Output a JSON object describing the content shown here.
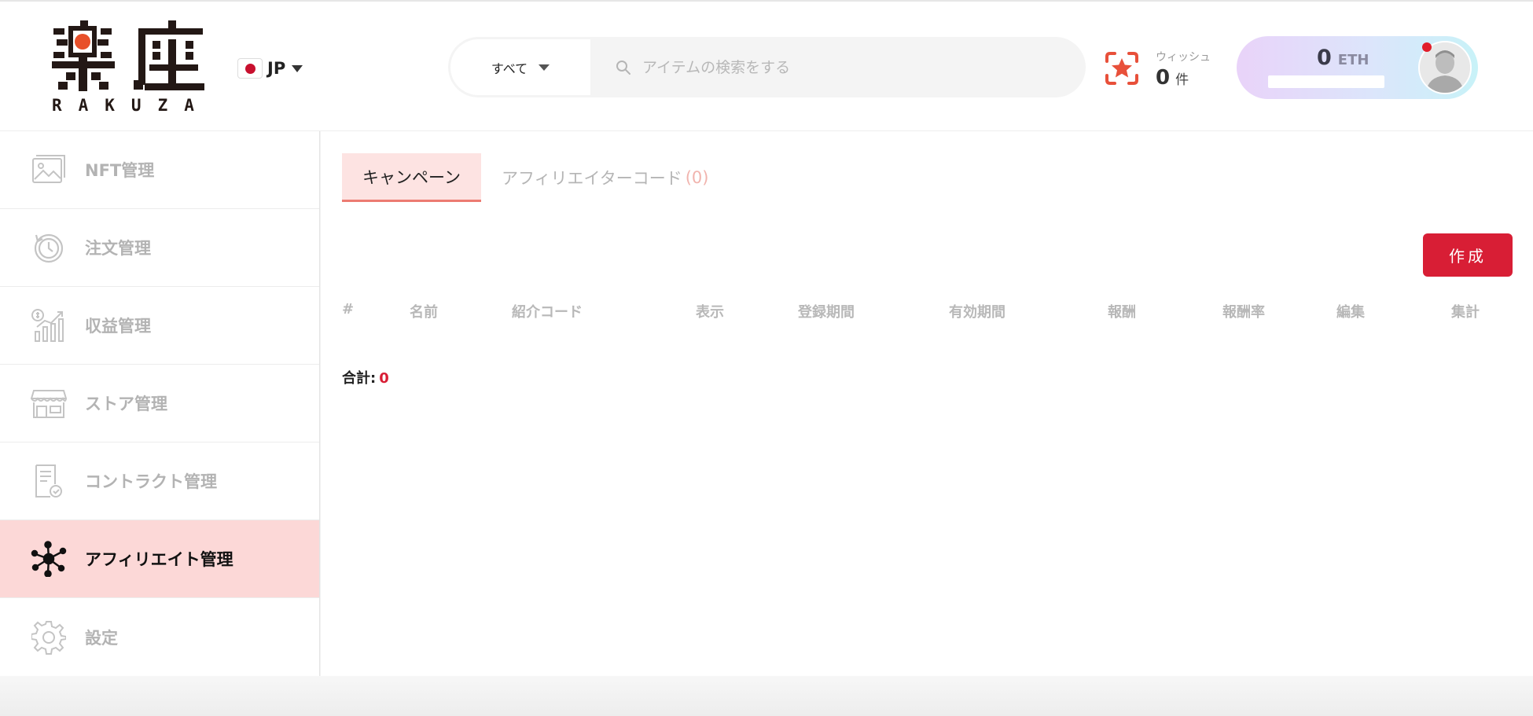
{
  "header": {
    "logo": {
      "kanji": "楽座",
      "text": "RAKUZA"
    },
    "language": {
      "flag_icon": "japan-flag-icon",
      "label": "JP"
    },
    "search": {
      "category_label": "すべて",
      "placeholder": "アイテムの検索をする",
      "value": ""
    },
    "wishlist": {
      "label": "ウィッシュ",
      "count": "0",
      "unit": "件"
    },
    "wallet": {
      "amount": "0",
      "currency": "ETH"
    }
  },
  "sidebar": {
    "items": [
      {
        "label": "NFT管理",
        "icon": "image-gallery-icon",
        "active": false
      },
      {
        "label": "注文管理",
        "icon": "clock-history-icon",
        "active": false
      },
      {
        "label": "収益管理",
        "icon": "revenue-chart-icon",
        "active": false
      },
      {
        "label": "ストア管理",
        "icon": "storefront-icon",
        "active": false
      },
      {
        "label": "コントラクト管理",
        "icon": "contract-document-icon",
        "active": false
      },
      {
        "label": "アフィリエイト管理",
        "icon": "network-nodes-icon",
        "active": true
      },
      {
        "label": "設定",
        "icon": "gear-icon",
        "active": false
      }
    ]
  },
  "main": {
    "tabs": [
      {
        "label": "キャンペーン",
        "count": "",
        "active": true
      },
      {
        "label": "アフィリエイターコード",
        "count": "(0)",
        "active": false
      }
    ],
    "create_button": "作成",
    "table": {
      "columns": [
        "#",
        "名前",
        "紹介コード",
        "表示",
        "登録期間",
        "有効期間",
        "報酬",
        "報酬率",
        "編集",
        "集計"
      ],
      "rows": []
    },
    "total": {
      "label": "合計:",
      "value": "0"
    }
  },
  "colors": {
    "accent": "#d81e35",
    "active_bg": "#fcd8d7",
    "tab_active_bg": "#fde3e2",
    "muted_text": "#b3b3b3"
  }
}
